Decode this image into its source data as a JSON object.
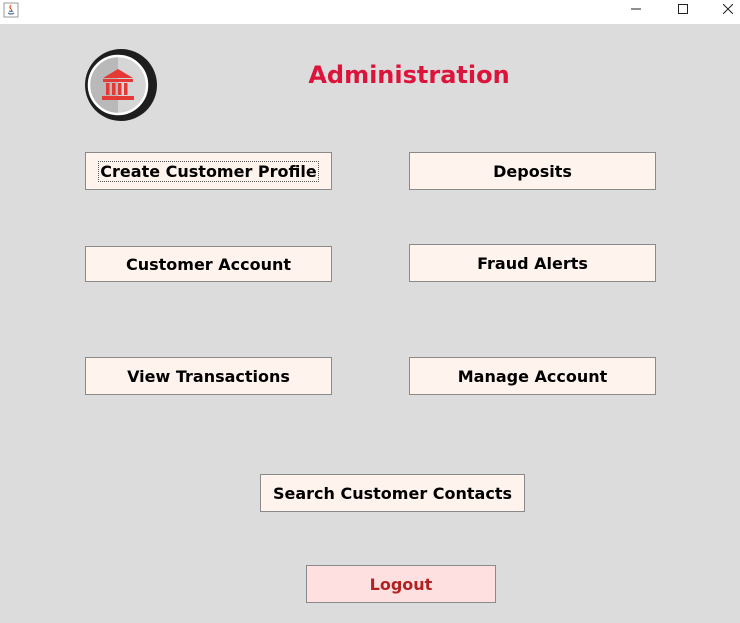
{
  "window": {
    "minimize_icon": "minimize-icon",
    "maximize_icon": "maximize-icon",
    "close_icon": "close-icon"
  },
  "header": {
    "title": "Administration",
    "title_color": "#dc143c",
    "logo_icon": "bank-icon"
  },
  "buttons": {
    "create_customer_profile": "Create Customer Profile",
    "deposits": "Deposits",
    "customer_account": "Customer Account",
    "fraud_alerts": "Fraud Alerts",
    "view_transactions": "View Transactions",
    "manage_account": "Manage Account",
    "search_customer_contacts": "Search Customer Contacts",
    "logout": "Logout"
  },
  "colors": {
    "background": "#dcdcdc",
    "button_bg": "#fff3ee",
    "logout_bg": "#ffe0e0",
    "logout_text": "#b22222"
  }
}
